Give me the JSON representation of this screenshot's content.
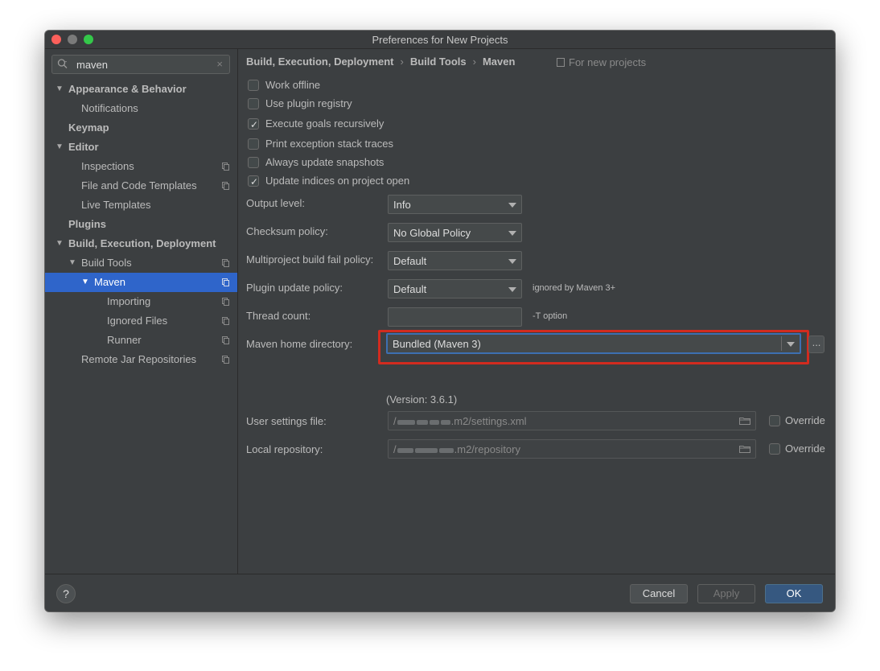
{
  "window": {
    "title": "Preferences for New Projects"
  },
  "search": {
    "value": "maven",
    "clear": "×"
  },
  "sidebar": {
    "items": [
      {
        "label": "Appearance & Behavior"
      },
      {
        "label": "Notifications"
      },
      {
        "label": "Keymap"
      },
      {
        "label": "Editor"
      },
      {
        "label": "Inspections"
      },
      {
        "label": "File and Code Templates"
      },
      {
        "label": "Live Templates"
      },
      {
        "label": "Plugins"
      },
      {
        "label": "Build, Execution, Deployment"
      },
      {
        "label": "Build Tools"
      },
      {
        "label": "Maven"
      },
      {
        "label": "Importing"
      },
      {
        "label": "Ignored Files"
      },
      {
        "label": "Runner"
      },
      {
        "label": "Remote Jar Repositories"
      }
    ]
  },
  "breadcrumb": {
    "items": [
      "Build, Execution, Deployment",
      "Build Tools",
      "Maven"
    ],
    "separator": "›",
    "scope": "For new projects"
  },
  "checkboxes": [
    {
      "label": "Work offline",
      "checked": false
    },
    {
      "label": "Use plugin registry",
      "checked": false
    },
    {
      "label": "Execute goals recursively",
      "checked": true
    },
    {
      "label": "Print exception stack traces",
      "checked": false
    },
    {
      "label": "Always update snapshots",
      "checked": false
    },
    {
      "label": "Update indices on project open",
      "checked": true
    }
  ],
  "check_glyph": "✓",
  "fields": {
    "output_level": {
      "label": "Output level:",
      "value": "Info"
    },
    "checksum_policy": {
      "label": "Checksum policy:",
      "value": "No Global Policy"
    },
    "fail_policy": {
      "label": "Multiproject build fail policy:",
      "value": "Default"
    },
    "plugin_update": {
      "label": "Plugin update policy:",
      "value": "Default",
      "hint": "ignored by Maven 3+"
    },
    "thread_count": {
      "label": "Thread count:",
      "value": "",
      "hint": "-T option"
    },
    "maven_home": {
      "label": "Maven home directory:",
      "value": "Bundled (Maven 3)",
      "browse": "...",
      "version": "(Version: 3.6.1)"
    },
    "user_settings": {
      "label": "User settings file:",
      "prefix": "/",
      "suffix": ".m2/settings.xml",
      "override": "Override"
    },
    "local_repo": {
      "label": "Local repository:",
      "prefix": "/",
      "suffix": ".m2/repository",
      "override": "Override"
    }
  },
  "footer": {
    "help": "?",
    "cancel": "Cancel",
    "apply": "Apply",
    "ok": "OK"
  },
  "colors": {
    "selection": "#2f65ca",
    "highlight_border": "#d22b1f",
    "primary_button": "#365880"
  }
}
